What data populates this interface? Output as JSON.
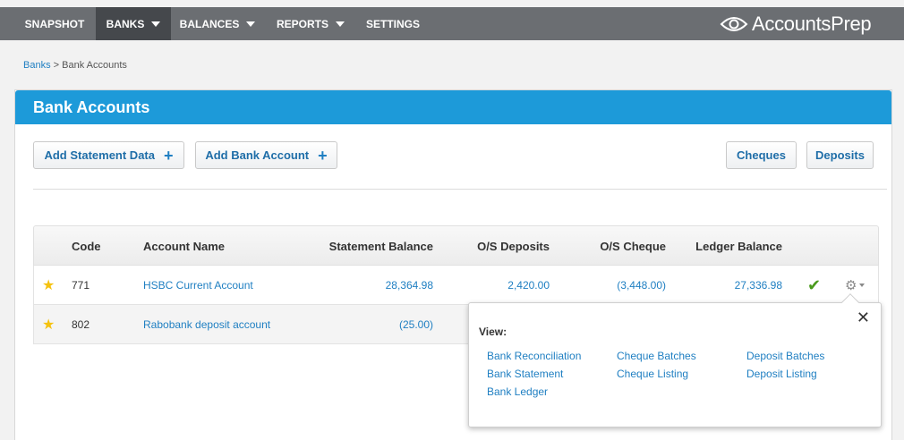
{
  "nav": {
    "items": [
      {
        "label": "SNAPSHOT",
        "has_caret": false
      },
      {
        "label": "BANKS",
        "has_caret": true
      },
      {
        "label": "BALANCES",
        "has_caret": true
      },
      {
        "label": "REPORTS",
        "has_caret": true
      },
      {
        "label": "SETTINGS",
        "has_caret": false
      }
    ],
    "active": "BANKS",
    "brand": "AccountsPrep"
  },
  "breadcrumb": {
    "link": "Banks",
    "separator": " > ",
    "current": "Bank Accounts"
  },
  "panel": {
    "title": "Bank Accounts"
  },
  "toolbar": {
    "add_statement": "Add Statement Data",
    "add_bank_account": "Add Bank Account",
    "cheques": "Cheques",
    "deposits": "Deposits",
    "plus_icon": "+"
  },
  "table": {
    "headers": [
      "Code",
      "Account Name",
      "Statement Balance",
      "O/S Deposits",
      "O/S Cheque",
      "Ledger Balance"
    ],
    "rows": [
      {
        "starred": true,
        "code": "771",
        "name": "HSBC Current Account",
        "statement_balance": "28,364.98",
        "os_deposits": "2,420.00",
        "os_cheque": "(3,448.00)",
        "ledger_balance": "27,336.98",
        "reconciled": true
      },
      {
        "starred": true,
        "code": "802",
        "name": "Rabobank deposit account",
        "statement_balance": "(25.00)",
        "os_deposits": "",
        "os_cheque": "",
        "ledger_balance": "",
        "reconciled": false
      }
    ]
  },
  "popover": {
    "title": "View:",
    "close": "✕",
    "links": [
      "Bank Reconciliation",
      "Bank Statement",
      "Bank Ledger",
      "Cheque Batches",
      "Cheque Listing",
      "Deposit Batches",
      "Deposit Listing"
    ]
  },
  "icons": {
    "star": "star-icon",
    "check": "checkmark-icon",
    "gear": "gear-icon",
    "close": "close-icon",
    "caret": "chevron-down-icon"
  },
  "colors": {
    "accent": "#1d9ad9",
    "nav": "#6b6e72",
    "nav_active": "#45484c",
    "link": "#1f7fc2",
    "star": "#f5c20f",
    "check": "#4a9a1c"
  }
}
